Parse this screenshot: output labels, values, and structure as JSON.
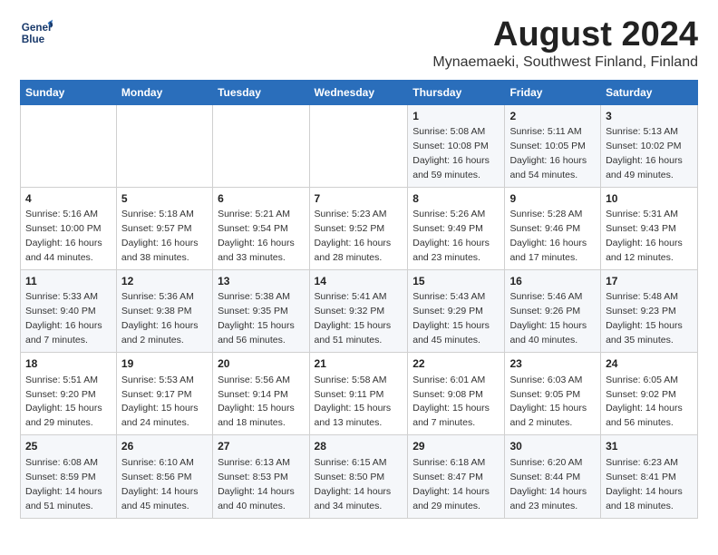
{
  "logo": {
    "line1": "General",
    "line2": "Blue"
  },
  "title": "August 2024",
  "location": "Mynaemaeki, Southwest Finland, Finland",
  "days_of_week": [
    "Sunday",
    "Monday",
    "Tuesday",
    "Wednesday",
    "Thursday",
    "Friday",
    "Saturday"
  ],
  "weeks": [
    [
      {
        "day": "",
        "info": ""
      },
      {
        "day": "",
        "info": ""
      },
      {
        "day": "",
        "info": ""
      },
      {
        "day": "",
        "info": ""
      },
      {
        "day": "1",
        "info": "Sunrise: 5:08 AM\nSunset: 10:08 PM\nDaylight: 16 hours\nand 59 minutes."
      },
      {
        "day": "2",
        "info": "Sunrise: 5:11 AM\nSunset: 10:05 PM\nDaylight: 16 hours\nand 54 minutes."
      },
      {
        "day": "3",
        "info": "Sunrise: 5:13 AM\nSunset: 10:02 PM\nDaylight: 16 hours\nand 49 minutes."
      }
    ],
    [
      {
        "day": "4",
        "info": "Sunrise: 5:16 AM\nSunset: 10:00 PM\nDaylight: 16 hours\nand 44 minutes."
      },
      {
        "day": "5",
        "info": "Sunrise: 5:18 AM\nSunset: 9:57 PM\nDaylight: 16 hours\nand 38 minutes."
      },
      {
        "day": "6",
        "info": "Sunrise: 5:21 AM\nSunset: 9:54 PM\nDaylight: 16 hours\nand 33 minutes."
      },
      {
        "day": "7",
        "info": "Sunrise: 5:23 AM\nSunset: 9:52 PM\nDaylight: 16 hours\nand 28 minutes."
      },
      {
        "day": "8",
        "info": "Sunrise: 5:26 AM\nSunset: 9:49 PM\nDaylight: 16 hours\nand 23 minutes."
      },
      {
        "day": "9",
        "info": "Sunrise: 5:28 AM\nSunset: 9:46 PM\nDaylight: 16 hours\nand 17 minutes."
      },
      {
        "day": "10",
        "info": "Sunrise: 5:31 AM\nSunset: 9:43 PM\nDaylight: 16 hours\nand 12 minutes."
      }
    ],
    [
      {
        "day": "11",
        "info": "Sunrise: 5:33 AM\nSunset: 9:40 PM\nDaylight: 16 hours\nand 7 minutes."
      },
      {
        "day": "12",
        "info": "Sunrise: 5:36 AM\nSunset: 9:38 PM\nDaylight: 16 hours\nand 2 minutes."
      },
      {
        "day": "13",
        "info": "Sunrise: 5:38 AM\nSunset: 9:35 PM\nDaylight: 15 hours\nand 56 minutes."
      },
      {
        "day": "14",
        "info": "Sunrise: 5:41 AM\nSunset: 9:32 PM\nDaylight: 15 hours\nand 51 minutes."
      },
      {
        "day": "15",
        "info": "Sunrise: 5:43 AM\nSunset: 9:29 PM\nDaylight: 15 hours\nand 45 minutes."
      },
      {
        "day": "16",
        "info": "Sunrise: 5:46 AM\nSunset: 9:26 PM\nDaylight: 15 hours\nand 40 minutes."
      },
      {
        "day": "17",
        "info": "Sunrise: 5:48 AM\nSunset: 9:23 PM\nDaylight: 15 hours\nand 35 minutes."
      }
    ],
    [
      {
        "day": "18",
        "info": "Sunrise: 5:51 AM\nSunset: 9:20 PM\nDaylight: 15 hours\nand 29 minutes."
      },
      {
        "day": "19",
        "info": "Sunrise: 5:53 AM\nSunset: 9:17 PM\nDaylight: 15 hours\nand 24 minutes."
      },
      {
        "day": "20",
        "info": "Sunrise: 5:56 AM\nSunset: 9:14 PM\nDaylight: 15 hours\nand 18 minutes."
      },
      {
        "day": "21",
        "info": "Sunrise: 5:58 AM\nSunset: 9:11 PM\nDaylight: 15 hours\nand 13 minutes."
      },
      {
        "day": "22",
        "info": "Sunrise: 6:01 AM\nSunset: 9:08 PM\nDaylight: 15 hours\nand 7 minutes."
      },
      {
        "day": "23",
        "info": "Sunrise: 6:03 AM\nSunset: 9:05 PM\nDaylight: 15 hours\nand 2 minutes."
      },
      {
        "day": "24",
        "info": "Sunrise: 6:05 AM\nSunset: 9:02 PM\nDaylight: 14 hours\nand 56 minutes."
      }
    ],
    [
      {
        "day": "25",
        "info": "Sunrise: 6:08 AM\nSunset: 8:59 PM\nDaylight: 14 hours\nand 51 minutes."
      },
      {
        "day": "26",
        "info": "Sunrise: 6:10 AM\nSunset: 8:56 PM\nDaylight: 14 hours\nand 45 minutes."
      },
      {
        "day": "27",
        "info": "Sunrise: 6:13 AM\nSunset: 8:53 PM\nDaylight: 14 hours\nand 40 minutes."
      },
      {
        "day": "28",
        "info": "Sunrise: 6:15 AM\nSunset: 8:50 PM\nDaylight: 14 hours\nand 34 minutes."
      },
      {
        "day": "29",
        "info": "Sunrise: 6:18 AM\nSunset: 8:47 PM\nDaylight: 14 hours\nand 29 minutes."
      },
      {
        "day": "30",
        "info": "Sunrise: 6:20 AM\nSunset: 8:44 PM\nDaylight: 14 hours\nand 23 minutes."
      },
      {
        "day": "31",
        "info": "Sunrise: 6:23 AM\nSunset: 8:41 PM\nDaylight: 14 hours\nand 18 minutes."
      }
    ]
  ]
}
